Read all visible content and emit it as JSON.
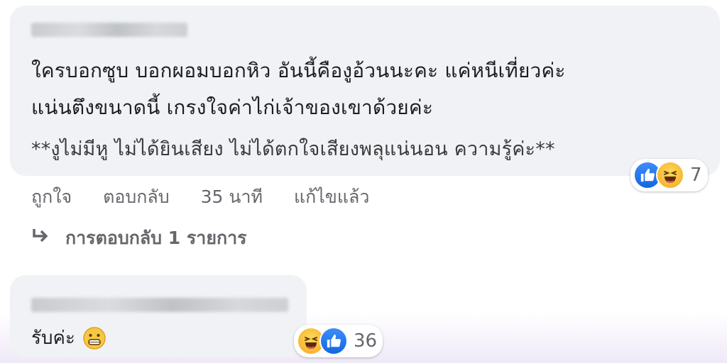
{
  "comment1": {
    "lines": [
      "ใครบอกซูบ บอกผอมบอกหิว อันนี้คืองูอ้วนนะคะ แค่หนีเที่ยวค่ะ",
      "แน่นตึงขนาดนี้ เกรงใจค่าไก่เจ้าของเขาด้วยค่ะ",
      "**งูไม่มีหู ไม่ได้ยินเสียง ไม่ได้ตกใจเสียงพลุแน่นอน ความรู้ค่ะ**"
    ],
    "reaction_count": "7",
    "reactions": [
      "like-icon",
      "haha-icon"
    ],
    "actions": {
      "like": "ถูกใจ",
      "reply": "ตอบกลับ",
      "time": "35 นาที",
      "edited": "แก้ไขแล้ว"
    },
    "replies_link": "การตอบกลับ 1 รายการ"
  },
  "comment2": {
    "text": "รับค่ะ",
    "reaction_count": "36",
    "reactions": [
      "haha-icon",
      "like-icon"
    ]
  },
  "colors": {
    "bubble": "#f0f2f5",
    "meta_text": "#65676b",
    "like_blue": "#1877f2",
    "haha_yellow": "#f7b125"
  }
}
